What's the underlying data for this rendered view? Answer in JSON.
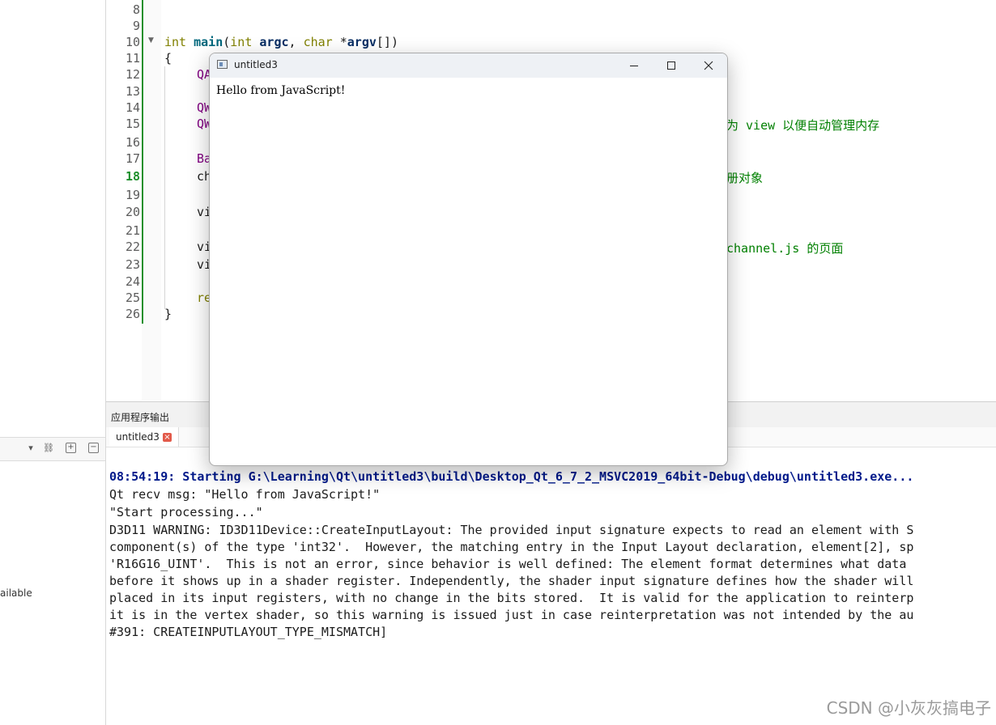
{
  "editor": {
    "line_numbers": [
      "8",
      "9",
      "10",
      "11",
      "12",
      "13",
      "14",
      "15",
      "16",
      "17",
      "18",
      "19",
      "20",
      "21",
      "22",
      "23",
      "24",
      "25",
      "26"
    ],
    "current_line": "18",
    "code_lines": {
      "l10_kw1": "int",
      "l10_fn": "main",
      "l10_p1": "(",
      "l10_kw2": "int",
      "l10_argc": "argc",
      "l10_sep": ", ",
      "l10_kw3": "char",
      "l10_star": " *",
      "l10_argv": "argv",
      "l10_end": "[])",
      "l11": "{",
      "l12": "QA",
      "l14": "QW",
      "l15": "QW",
      "l17": "Ba",
      "l18": "ch",
      "l20": "vi",
      "l22": "vi",
      "l23": "vi",
      "l25": "re",
      "l26": "}"
    },
    "comments": {
      "l15": "为 view 以便自动管理内存",
      "l18": "册对象",
      "l22": "channel.js 的页面"
    }
  },
  "output": {
    "header": "应用程序输出",
    "tab_label": "untitled3",
    "lines": [
      "08:54:19: Starting G:\\Learning\\Qt\\untitled3\\build\\Desktop_Qt_6_7_2_MSVC2019_64bit-Debug\\debug\\untitled3.exe...",
      "Qt recv msg: \"Hello from JavaScript!\"",
      "\"Start processing...\"",
      "D3D11 WARNING: ID3D11Device::CreateInputLayout: The provided input signature expects to read an element with S",
      "component(s) of the type 'int32'.  However, the matching entry in the Input Layout declaration, element[2], sp",
      "'R16G16_UINT'.  This is not an error, since behavior is well defined: The element format determines what data",
      "before it shows up in a shader register. Independently, the shader input signature defines how the shader will",
      "placed in its input registers, with no change in the bits stored.  It is valid for the application to reinterp",
      "it is in the vertex shader, so this warning is issued just in case reinterpretation was not intended by the au",
      "#391: CREATEINPUTLAYOUT_TYPE_MISMATCH]"
    ]
  },
  "left_panel": {
    "unavailable_text": "ailable"
  },
  "window": {
    "title": "untitled3",
    "content": "Hello from JavaScript!"
  },
  "watermark": "CSDN @小灰灰搞电子"
}
